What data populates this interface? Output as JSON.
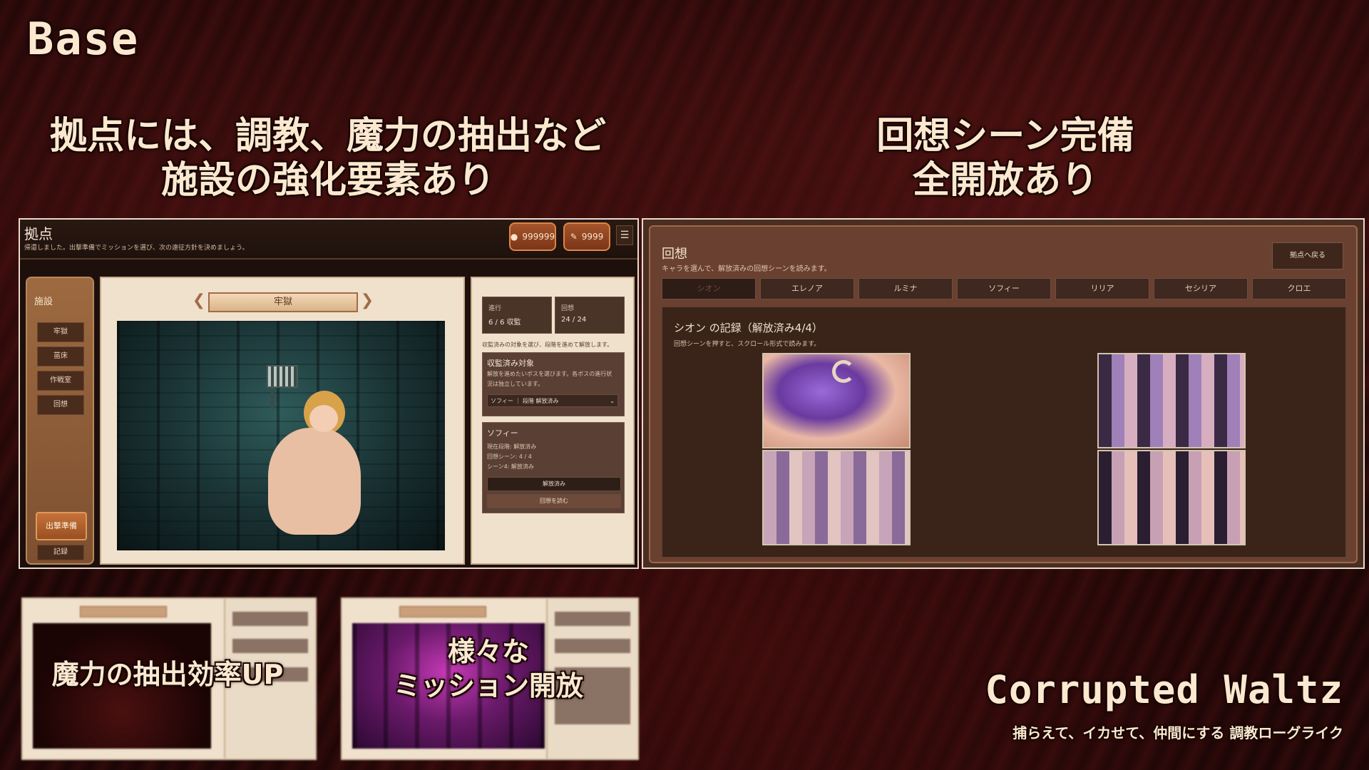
{
  "header": {
    "base_title": "Base",
    "left_caption_line1": "拠点には、調教、魔力の抽出など",
    "left_caption_line2": "施設の強化要素あり",
    "right_caption_line1": "回想シーン完備",
    "right_caption_line2": "全開放あり"
  },
  "base_screen": {
    "title": "拠点",
    "subtitle": "帰還しました。出撃準備でミッションを選び、次の遠征方針を決めましょう。",
    "currency1": "999999",
    "currency2": "9999",
    "menu_glyph": "☰",
    "facilities_title": "施設",
    "facilities": [
      "牢獄",
      "苗床",
      "作戦室",
      "回想"
    ],
    "sortie_label": "出撃準備",
    "record_label": "記録",
    "room_name": "牢獄",
    "stat_progress_label": "進行",
    "stat_progress_value": "6 / 6 収監",
    "stat_recall_label": "回想",
    "stat_recall_value": "24 / 24",
    "note": "収監済みの対象を選び、段階を進めて解放します。",
    "captured_title": "収監済み対象",
    "captured_desc1": "解放を進めたいボスを選びます。各ボスの進行状",
    "captured_desc2": "況は独立しています。",
    "captured_select": "ソフィー ｜ 段階 解放済み",
    "captive_name": "ソフィー",
    "captive_line1": "現在段階: 解放済み",
    "captive_line2": "回想シーン: 4 / 4",
    "captive_line3": "シーン4: 解放済み",
    "btn_released": "解放済み",
    "btn_read_recall": "回想を読む"
  },
  "recall_screen": {
    "title": "回想",
    "subtitle": "キャラを選んで、解放済みの回想シーンを読みます。",
    "back_label": "拠点へ戻る",
    "tabs": [
      "シオン",
      "エレノア",
      "ルミナ",
      "ソフィー",
      "リリア",
      "セシリア",
      "クロエ"
    ],
    "record_title": "シオン の記録（解放済み4/4）",
    "record_hint": "回想シーンを押すと、スクロール形式で読みます。"
  },
  "bottom": {
    "caption_left": "魔力の抽出効率UP",
    "caption_right_line1": "様々な",
    "caption_right_line2": "ミッション開放"
  },
  "brand": {
    "logo_text": "Corrupted Waltz",
    "tagline": "捕らえて、イカせて、仲間にする 調教ローグライク"
  }
}
